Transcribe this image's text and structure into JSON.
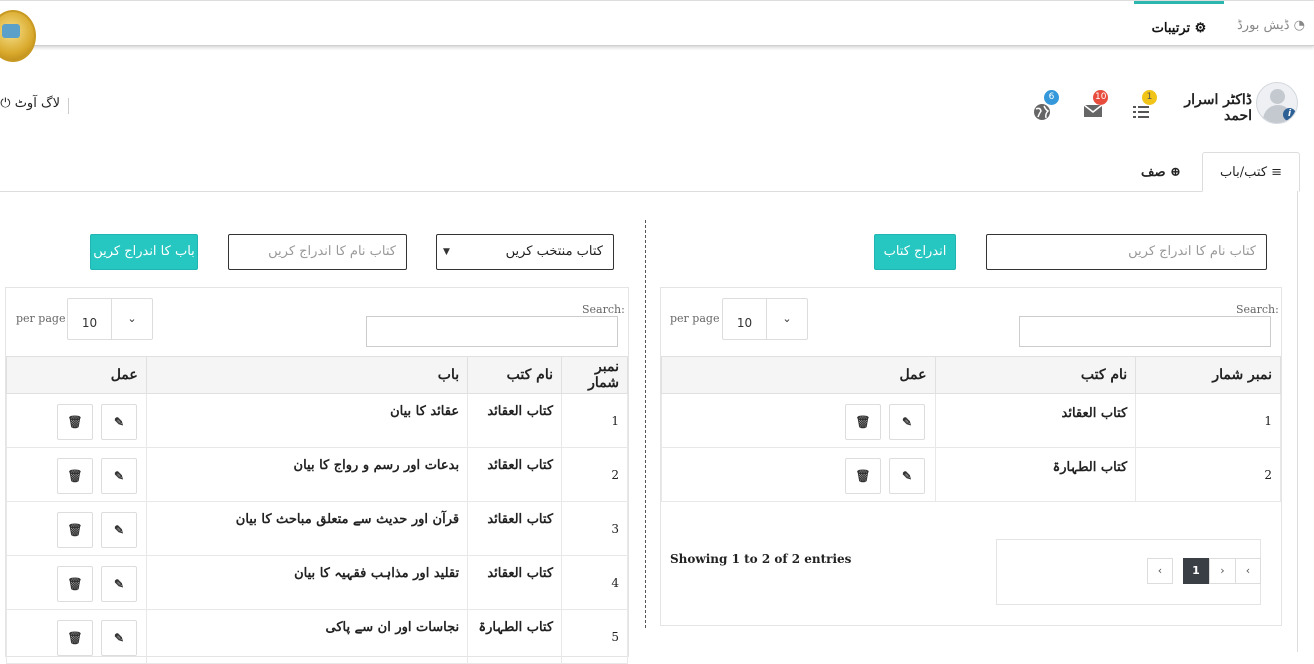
{
  "nav": {
    "dashboard": "ڈیش بورڈ",
    "settings": "ترتیبات"
  },
  "header": {
    "logout": "لاگ آوٹ",
    "username": "ڈاکٹر اسرار احمد",
    "badges": {
      "list": "1",
      "mail": "10",
      "globe": "6"
    }
  },
  "tabs": {
    "kutub_bab": "کتب/باب",
    "saf": "صف"
  },
  "left_form": {
    "book_name_placeholder": "کتاب نام کا اندراج کریں",
    "add_book_button": "اندراج کتاب"
  },
  "right_form": {
    "select_book": "کتاب منتخب کریں",
    "book_name_placeholder": "کتاب نام کا اندراج کریں",
    "add_chapter_button": "باب کا اندراج کریں"
  },
  "books_table": {
    "search_label": "Search:",
    "per_page_label": "per page",
    "per_page_value": "10",
    "columns": [
      "نمبر شمار",
      "نام کتب",
      "عمل"
    ],
    "rows": [
      {
        "num": "1",
        "name": "کتاب العقائد"
      },
      {
        "num": "2",
        "name": "کتاب الطہارۃ"
      }
    ],
    "showing": "Showing 1 to 2 of 2 entries",
    "pagination": {
      "prev": "‹",
      "current": "1",
      "next": "›",
      "prev2": "‹",
      "next2": "›"
    }
  },
  "chapters_table": {
    "search_label": "Search:",
    "per_page_label": "per page",
    "per_page_value": "10",
    "columns": [
      "نمبر شمار",
      "نام کتب",
      "باب",
      "عمل"
    ],
    "rows": [
      {
        "num": "1",
        "book": "کتاب العقائد",
        "chapter": "عقائد کا بیان"
      },
      {
        "num": "2",
        "book": "کتاب العقائد",
        "chapter": "بدعات اور رسم و رواج کا بیان"
      },
      {
        "num": "3",
        "book": "کتاب العقائد",
        "chapter": "قرآن اور حدیث سے متعلق مباحث کا بیان"
      },
      {
        "num": "4",
        "book": "کتاب العقائد",
        "chapter": "تقلید اور مذاہب فقہیہ کا بیان"
      },
      {
        "num": "5",
        "book": "کتاب الطہارۃ",
        "chapter": "نجاسات اور ان سے پاکی"
      }
    ]
  },
  "colors": {
    "accent": "#26c6c1",
    "badge_yellow": "#f0c419",
    "badge_red": "#e74c3c",
    "badge_blue": "#3498db"
  }
}
